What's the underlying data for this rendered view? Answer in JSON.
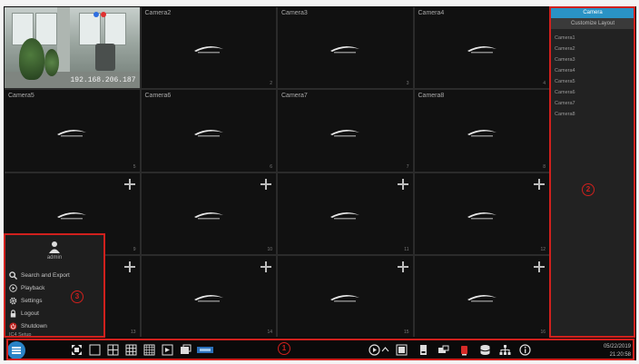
{
  "grid": {
    "cells": [
      {
        "name": "",
        "number": "",
        "type": "live",
        "ip": "192.168.206.187"
      },
      {
        "name": "Camera2",
        "number": "2",
        "type": "camera"
      },
      {
        "name": "Camera3",
        "number": "3",
        "type": "camera"
      },
      {
        "name": "Camera4",
        "number": "4",
        "type": "camera"
      },
      {
        "name": "Camera5",
        "number": "5",
        "type": "camera"
      },
      {
        "name": "Camera6",
        "number": "6",
        "type": "camera"
      },
      {
        "name": "Camera7",
        "number": "7",
        "type": "camera"
      },
      {
        "name": "Camera8",
        "number": "8",
        "type": "camera"
      },
      {
        "name": "",
        "number": "9",
        "type": "empty"
      },
      {
        "name": "",
        "number": "10",
        "type": "empty"
      },
      {
        "name": "",
        "number": "11",
        "type": "empty"
      },
      {
        "name": "",
        "number": "12",
        "type": "empty"
      },
      {
        "name": "",
        "number": "13",
        "type": "empty"
      },
      {
        "name": "",
        "number": "14",
        "type": "empty"
      },
      {
        "name": "",
        "number": "15",
        "type": "empty"
      },
      {
        "name": "",
        "number": "16",
        "type": "empty"
      }
    ]
  },
  "right_panel": {
    "tabs": [
      "Camera",
      "Customize Layout"
    ],
    "cameras": [
      "Camera1",
      "Camera2",
      "Camera3",
      "Camera4",
      "Camera5",
      "Camera6",
      "Camera7",
      "Camera8"
    ]
  },
  "start_menu": {
    "user": "admin",
    "items": [
      {
        "label": "Search and Export",
        "icon": "search-icon"
      },
      {
        "label": "Playback",
        "icon": "playback-icon"
      },
      {
        "label": "Settings",
        "icon": "gear-icon"
      },
      {
        "label": "Logout",
        "icon": "lock-icon"
      },
      {
        "label": "Shutdown",
        "icon": "power-icon"
      }
    ],
    "footer": "IC4 Setup"
  },
  "markers": {
    "taskbar": "1",
    "right_panel": "2",
    "start_menu": "3"
  },
  "clock": {
    "date": "05/22/2019",
    "time": "21:20:58"
  },
  "colors": {
    "marker": "#d0201d",
    "accent": "#2a93c5"
  }
}
